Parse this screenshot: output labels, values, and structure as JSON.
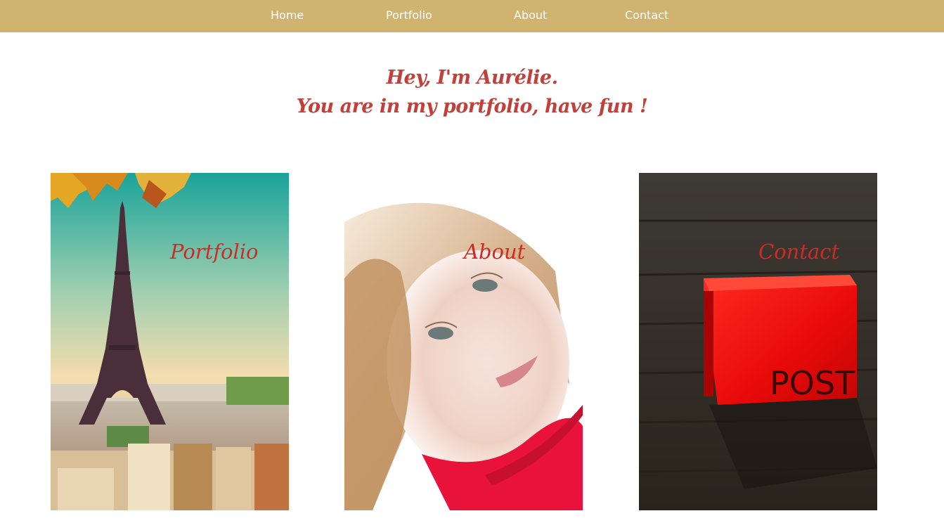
{
  "nav": {
    "items": [
      {
        "label": "Home"
      },
      {
        "label": "Portfolio"
      },
      {
        "label": "About"
      },
      {
        "label": "Contact"
      }
    ]
  },
  "hero": {
    "line1": "Hey, I'm Aurélie.",
    "line2": "You are in my portfolio, have fun !"
  },
  "cards": [
    {
      "label": "Portfolio",
      "image": "eiffel-tower-photo"
    },
    {
      "label": "About",
      "image": "portrait-photo"
    },
    {
      "label": "Contact",
      "image": "red-mailbox-photo",
      "image_text": "POST"
    }
  ],
  "colors": {
    "nav_background": "#d0b36e",
    "nav_text": "#ffffff",
    "accent_red": "#c1413a"
  }
}
